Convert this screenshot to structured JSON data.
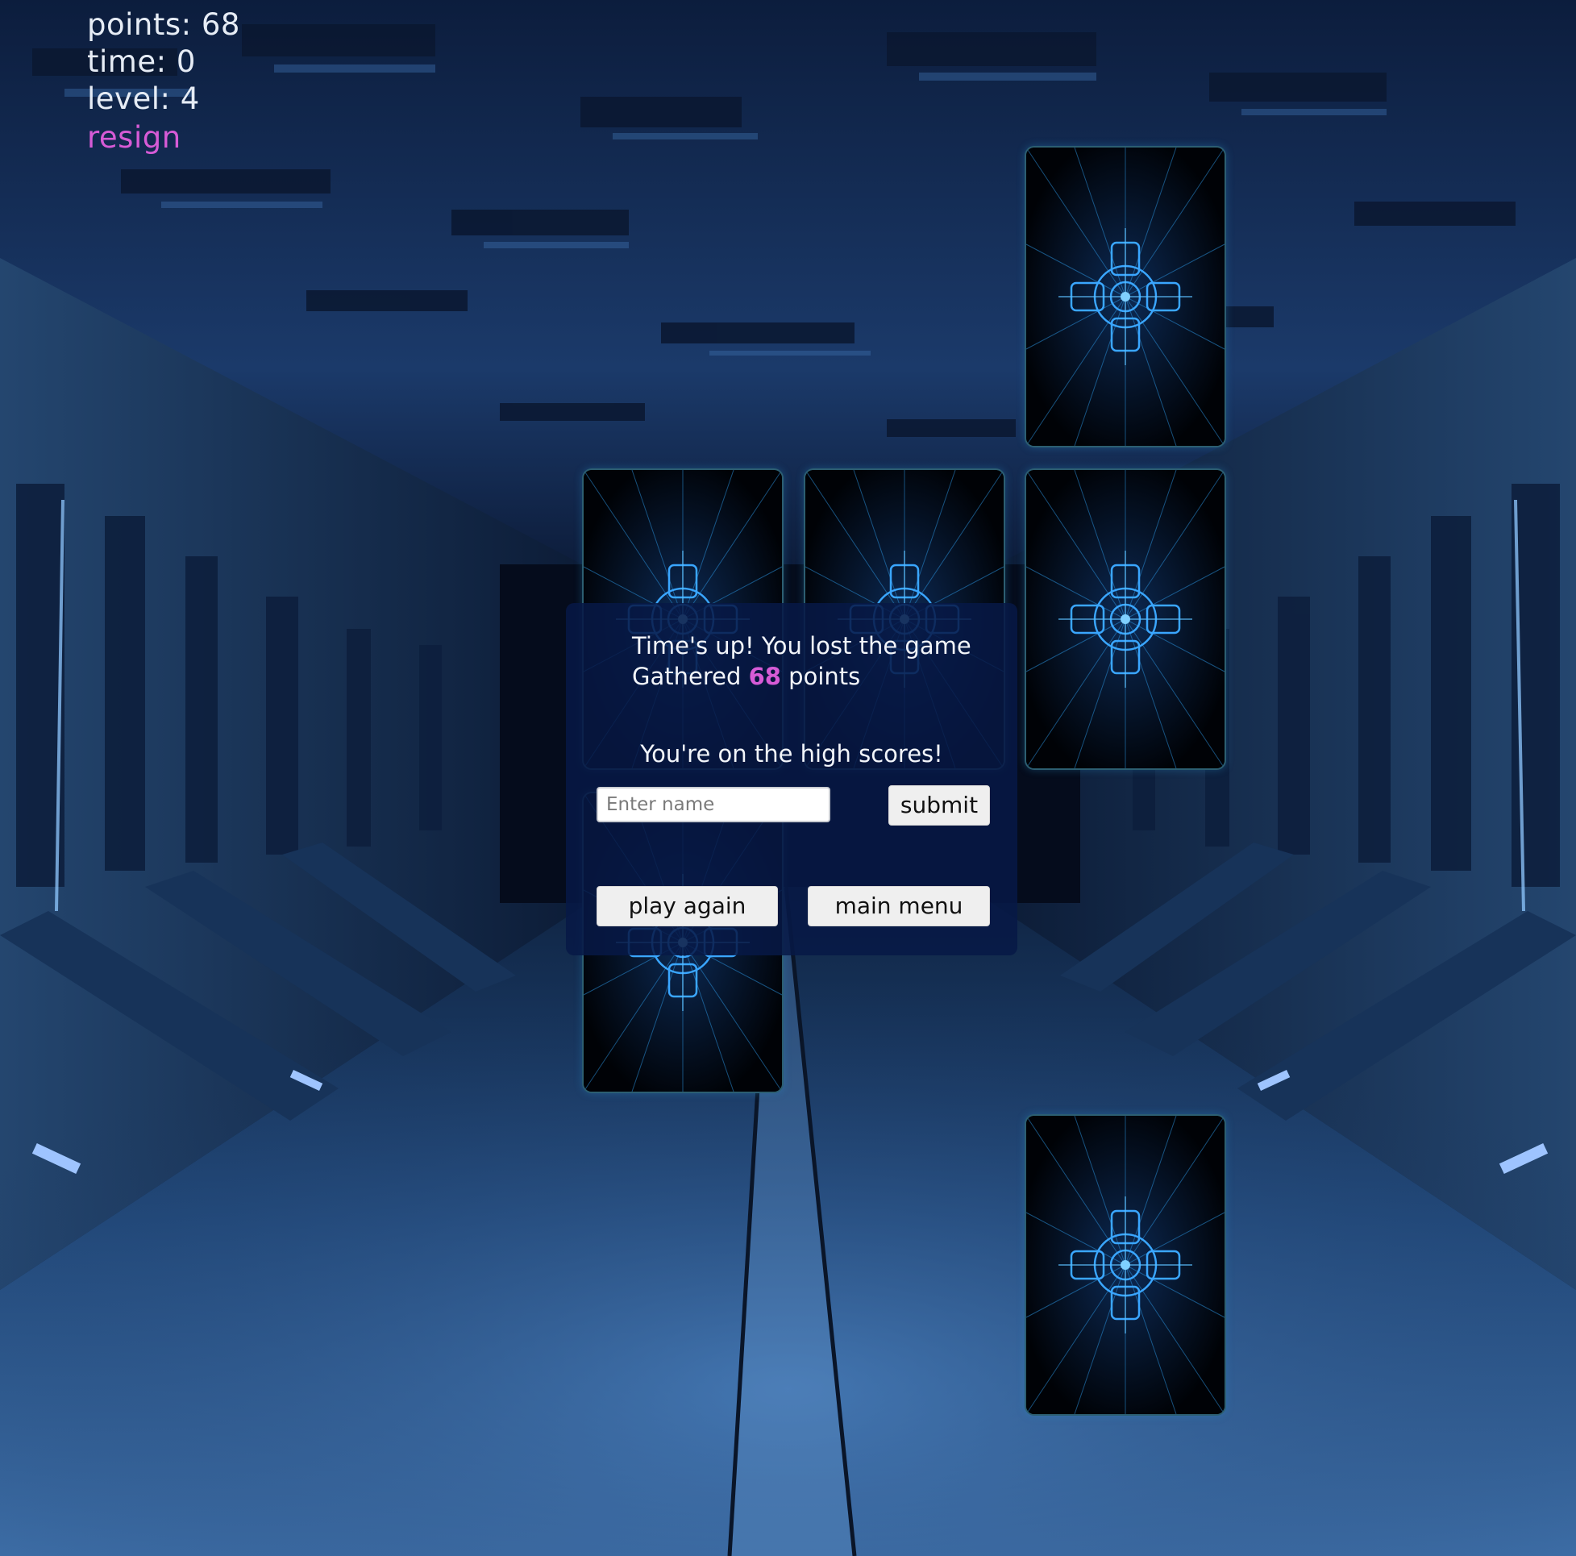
{
  "hud": {
    "points": "points: 68",
    "time": "time: 0",
    "level": "level: 4",
    "resign": "resign"
  },
  "modal": {
    "title": "Time's up! You lost the game",
    "gathered_prefix": "Gathered",
    "gathered_points": "68",
    "gathered_suffix": "points",
    "high_scores": "You're on the high scores!",
    "name_placeholder": "Enter name",
    "submit_label": "submit",
    "play_again_label": "play again",
    "main_menu_label": "main menu"
  },
  "cards": [
    {
      "name": "card-back-1",
      "face": "down"
    },
    {
      "name": "card-back-2",
      "face": "down"
    },
    {
      "name": "card-back-3",
      "face": "down"
    },
    {
      "name": "card-back-4",
      "face": "down"
    },
    {
      "name": "card-back-5",
      "face": "down"
    },
    {
      "name": "card-back-6",
      "face": "down"
    }
  ],
  "colors": {
    "accent": "#d65bd6",
    "hud_text": "#e6ecf5",
    "card_border": "#4fa8c6",
    "card_glow": "#2b9bd6",
    "modal_bg": "#071846"
  }
}
